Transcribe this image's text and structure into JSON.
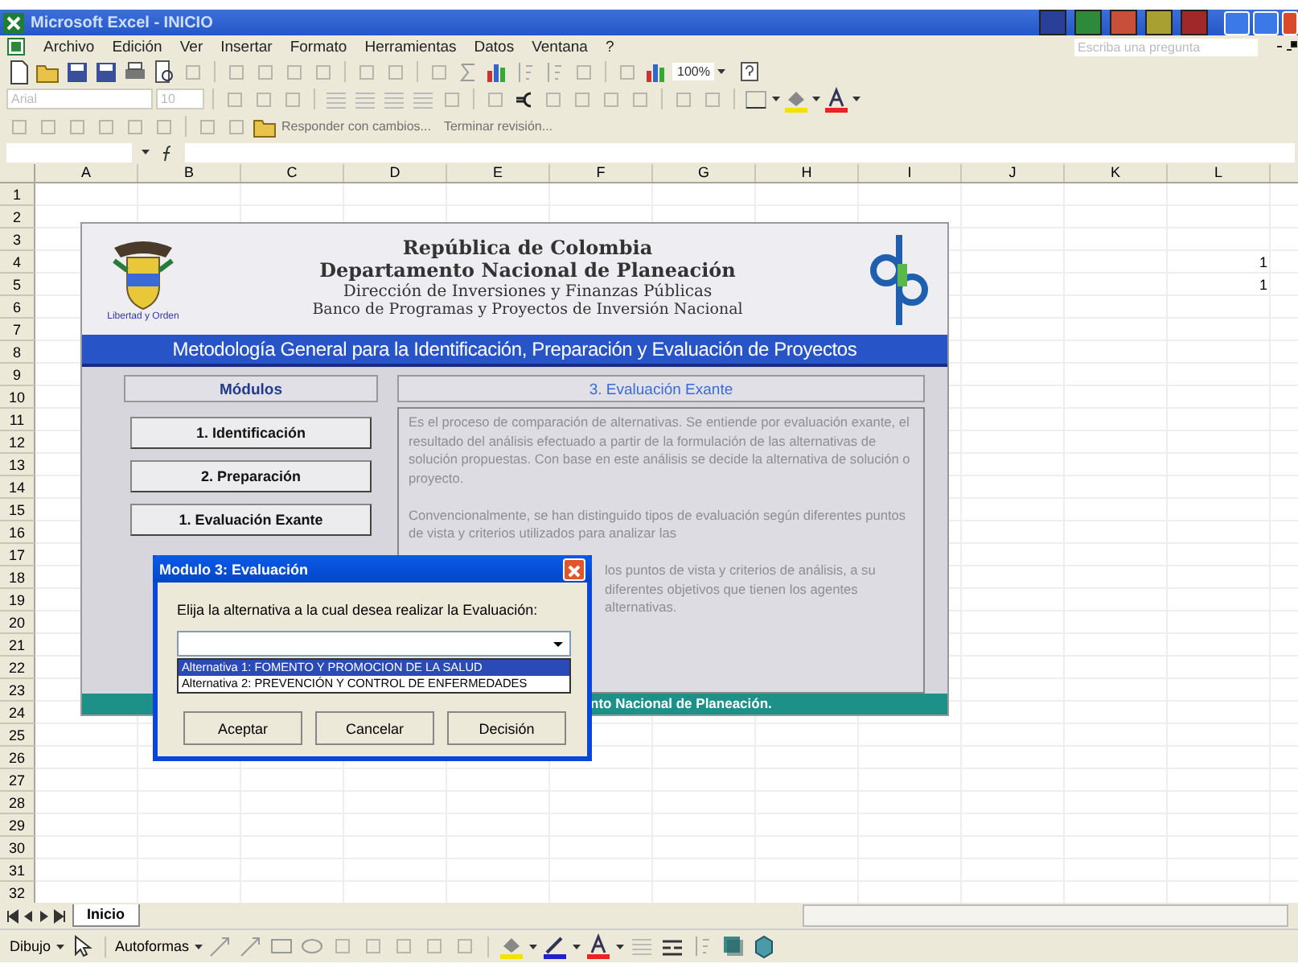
{
  "window": {
    "title": "Microsoft Excel - INICIO"
  },
  "help_box": {
    "placeholder": "Escriba una pregunta"
  },
  "menu": [
    "Archivo",
    "Edición",
    "Ver",
    "Insertar",
    "Formato",
    "Herramientas",
    "Datos",
    "Ventana",
    "?"
  ],
  "toolbar": {
    "zoom": "100%",
    "font": "Arial",
    "font_size": "10",
    "review": "Responder con cambios...",
    "end_review": "Terminar revisión..."
  },
  "columns": [
    "A",
    "B",
    "C",
    "D",
    "E",
    "F",
    "G",
    "H",
    "I",
    "J",
    "K",
    "L"
  ],
  "rows": [
    {
      "label": "1"
    },
    {
      "label": "2"
    },
    {
      "label": "3"
    },
    {
      "label": "4",
      "column_l": "1"
    },
    {
      "label": "5",
      "column_l": "1"
    },
    {
      "label": "6"
    },
    {
      "label": "7"
    },
    {
      "label": "8"
    },
    {
      "label": "9"
    },
    {
      "label": "10"
    },
    {
      "label": "11"
    },
    {
      "label": "12"
    },
    {
      "label": "13"
    },
    {
      "label": "14"
    },
    {
      "label": "15"
    },
    {
      "label": "16"
    },
    {
      "label": "17"
    },
    {
      "label": "18"
    },
    {
      "label": "19"
    },
    {
      "label": "20"
    },
    {
      "label": "21"
    },
    {
      "label": "22"
    },
    {
      "label": "23"
    },
    {
      "label": "24"
    },
    {
      "label": "25"
    },
    {
      "label": "26"
    },
    {
      "label": "27"
    },
    {
      "label": "28"
    },
    {
      "label": "29"
    },
    {
      "label": "30"
    },
    {
      "label": "31"
    },
    {
      "label": "32"
    }
  ],
  "panel": {
    "header_lines": [
      "República de Colombia",
      "Departamento Nacional de Planeación",
      "Dirección de Inversiones y Finanzas Públicas",
      "Banco de Programas y Proyectos de Inversión Nacional"
    ],
    "seal_caption": "Libertad y Orden",
    "banner": "Metodología General para la Identificación, Preparación y Evaluación de Proyectos",
    "modules_title": "Módulos",
    "modules": [
      {
        "label": "1. Identificación"
      },
      {
        "label": "2. Preparación"
      },
      {
        "label": "1. Evaluación Exante"
      }
    ],
    "section_title": "3. Evaluación Exante",
    "description": [
      {
        "kind": "paragraph",
        "text": "Es el proceso de comparación de alternativas. Se entiende por evaluación exante, el resultado del análisis efectuado a partir de la formulación de las alternativas de solución propuestas. Con base en este análisis se decide la alternativa de solución o proyecto."
      },
      {
        "kind": "paragraph",
        "text": "Convencionalmente, se han distinguido tipos de evaluación según diferentes puntos de vista y criterios utilizados para analizar las"
      },
      {
        "kind": "partial",
        "text": "los puntos de vista y criterios de análisis, a su"
      },
      {
        "kind": "partial",
        "text": "diferentes objetivos que tienen los agentes"
      },
      {
        "kind": "partial",
        "text": "alternativas."
      }
    ],
    "footer": "nto Nacional de Planeación."
  },
  "dialog": {
    "title": "Modulo 3: Evaluación",
    "prompt": "Elija la alternativa a la cual desea realizar la Evaluación:",
    "options": [
      {
        "label": "Alternativa 1: FOMENTO Y PROMOCION DE LA SALUD",
        "selected": true
      },
      {
        "label": "Alternativa 2: PREVENCIÓN Y CONTROL DE ENFERMEDADES",
        "selected": false
      }
    ],
    "buttons": [
      "Aceptar",
      "Cancelar",
      "Decisión"
    ]
  },
  "sheet_tabs": [
    {
      "label": "Inicio",
      "selected": true
    }
  ],
  "drawing_toolbar": {
    "draw": "Dibujo",
    "autoshapes": "Autoformas"
  }
}
